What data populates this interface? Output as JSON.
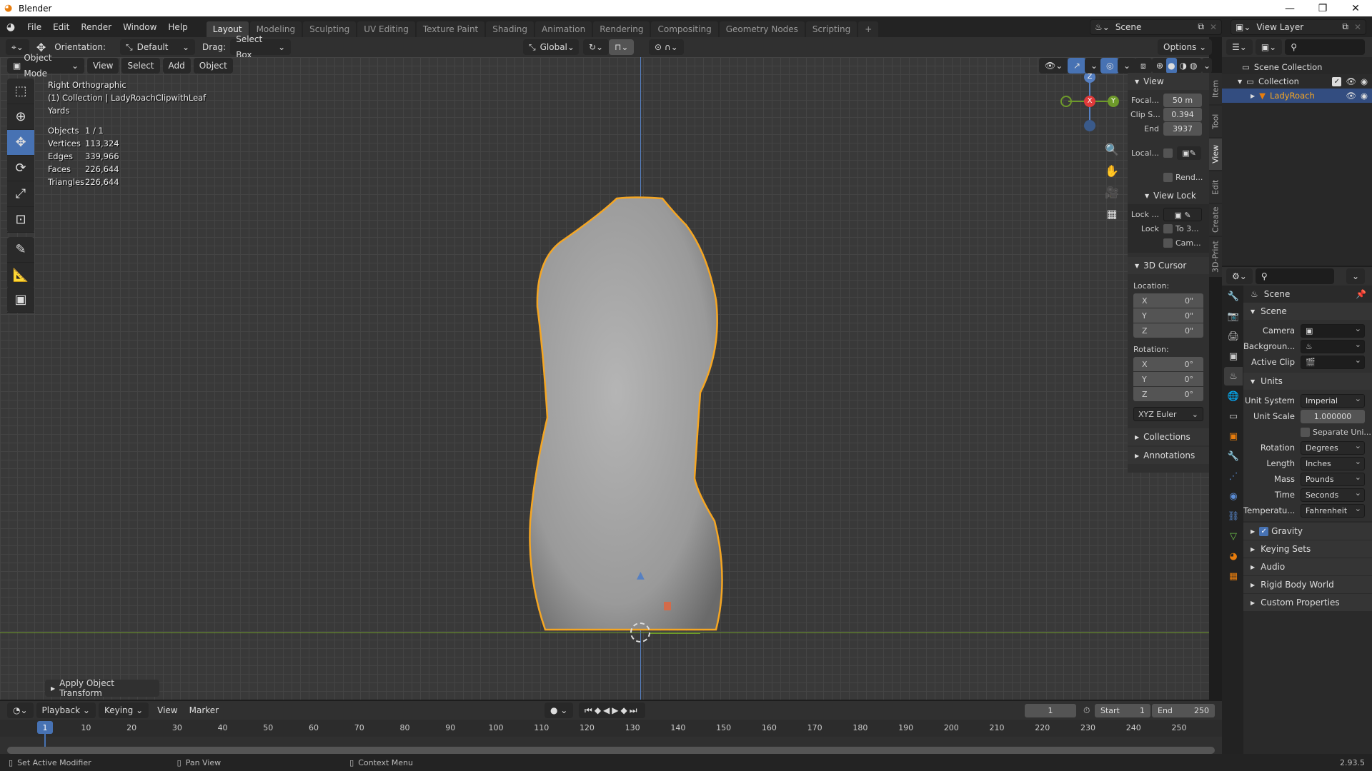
{
  "window": {
    "title": "Blender",
    "controls": [
      "minimize",
      "restore",
      "close"
    ]
  },
  "menu": {
    "items": [
      "File",
      "Edit",
      "Render",
      "Window",
      "Help"
    ]
  },
  "workspaces": [
    {
      "label": "Layout",
      "active": true
    },
    {
      "label": "Modeling"
    },
    {
      "label": "Sculpting"
    },
    {
      "label": "UV Editing"
    },
    {
      "label": "Texture Paint"
    },
    {
      "label": "Shading"
    },
    {
      "label": "Animation"
    },
    {
      "label": "Rendering"
    },
    {
      "label": "Compositing"
    },
    {
      "label": "Geometry Nodes"
    },
    {
      "label": "Scripting"
    }
  ],
  "add_workspace": "+",
  "scene_selector": {
    "value": "Scene"
  },
  "view_layer_selector": {
    "value": "View Layer"
  },
  "tool_header": {
    "orientation_label": "Orientation:",
    "orientation_value": "Default",
    "drag_label": "Drag:",
    "drag_value": "Select Box",
    "transform_orientation": "Global",
    "options": "Options"
  },
  "viewport_header": {
    "mode": "Object Mode",
    "menus": [
      "View",
      "Select",
      "Add",
      "Object"
    ]
  },
  "viewport_overlay": {
    "view_name": "Right Orthographic",
    "collection_info": "(1) Collection | LadyRoachClipwithLeaf",
    "units": "Yards",
    "stats": [
      {
        "label": "Objects",
        "value": "1 / 1"
      },
      {
        "label": "Vertices",
        "value": "113,324"
      },
      {
        "label": "Edges",
        "value": "339,966"
      },
      {
        "label": "Faces",
        "value": "226,644"
      },
      {
        "label": "Triangles",
        "value": "226,644"
      }
    ]
  },
  "gizmo_axes": {
    "z": "Z",
    "x": "X",
    "y": "Y"
  },
  "last_operator": "Apply Object Transform",
  "npanel": {
    "view_title": "View",
    "focal_label": "Focal...",
    "focal_value": "50 m",
    "clip_start_label": "Clip S...",
    "clip_start_value": "0.394",
    "clip_end_label": "End",
    "clip_end_value": "3937",
    "local_label": "Local...",
    "render_label": "Rend...",
    "view_lock_title": "View Lock",
    "lock_label": "Lock ...",
    "lock2_label": "Lock",
    "to3d_label": "To 3...",
    "cam_label": "Cam...",
    "cursor_title": "3D Cursor",
    "location_label": "Location:",
    "location": [
      {
        "axis": "X",
        "value": "0\""
      },
      {
        "axis": "Y",
        "value": "0\""
      },
      {
        "axis": "Z",
        "value": "0\""
      }
    ],
    "rotation_label": "Rotation:",
    "rotation": [
      {
        "axis": "X",
        "value": "0°"
      },
      {
        "axis": "Y",
        "value": "0°"
      },
      {
        "axis": "Z",
        "value": "0°"
      }
    ],
    "rotation_mode": "XYZ Euler",
    "collections": "Collections",
    "annotations": "Annotations",
    "tabs": [
      "Item",
      "Tool",
      "View",
      "Edit",
      "Create",
      "3D-Print"
    ]
  },
  "outliner": {
    "scene_collection": "Scene Collection",
    "collection": "Collection",
    "object": "LadyRoach"
  },
  "properties": {
    "context": "Scene",
    "scene_section": "Scene",
    "camera_label": "Camera",
    "background_label": "Backgroun...",
    "active_clip_label": "Active Clip",
    "units_section": "Units",
    "unit_system_label": "Unit System",
    "unit_system": "Imperial",
    "unit_scale_label": "Unit Scale",
    "unit_scale": "1.000000",
    "separate_units": "Separate Uni...",
    "rotation_label": "Rotation",
    "rotation": "Degrees",
    "length_label": "Length",
    "length": "Inches",
    "mass_label": "Mass",
    "mass": "Pounds",
    "time_label": "Time",
    "time": "Seconds",
    "temperature_label": "Temperatu...",
    "temperature": "Fahrenheit",
    "gravity": "Gravity",
    "keying_sets": "Keying Sets",
    "audio": "Audio",
    "rigid_body_world": "Rigid Body World",
    "custom_properties": "Custom Properties"
  },
  "timeline": {
    "menus": [
      "Playback",
      "Keying",
      "View",
      "Marker"
    ],
    "current_frame": "1",
    "start_label": "Start",
    "start": "1",
    "end_label": "End",
    "end": "250",
    "ticks": [
      "1",
      "10",
      "20",
      "30",
      "40",
      "50",
      "60",
      "70",
      "80",
      "90",
      "100",
      "110",
      "120",
      "130",
      "140",
      "150",
      "160",
      "170",
      "180",
      "190",
      "200",
      "210",
      "220",
      "230",
      "240",
      "250"
    ]
  },
  "statusbar": {
    "left": "Set Active Modifier",
    "middle": "Pan View",
    "right": "Context Menu",
    "version": "2.93.5"
  },
  "colors": {
    "accent": "#4772b3",
    "selection": "#f5a623",
    "object_orange": "#e87d0d"
  }
}
